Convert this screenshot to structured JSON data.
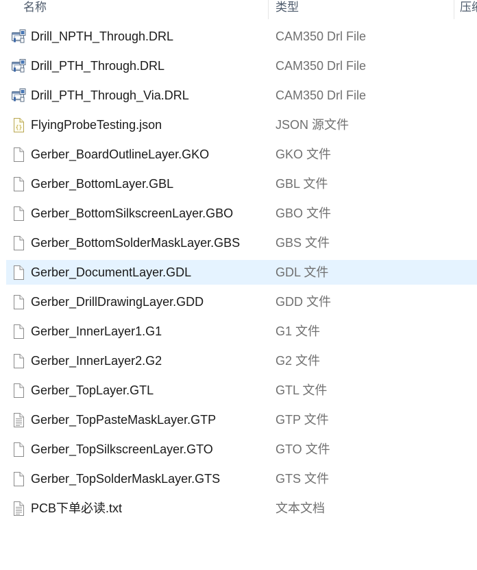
{
  "columns": {
    "name": "名称",
    "type": "类型",
    "size": "压缩"
  },
  "files": [
    {
      "name": "Drill_NPTH_Through.DRL",
      "type": "CAM350 Drl File",
      "icon": "cam350-drill-file-icon",
      "selected": false
    },
    {
      "name": "Drill_PTH_Through.DRL",
      "type": "CAM350 Drl File",
      "icon": "cam350-drill-file-icon",
      "selected": false
    },
    {
      "name": "Drill_PTH_Through_Via.DRL",
      "type": "CAM350 Drl File",
      "icon": "cam350-drill-file-icon",
      "selected": false
    },
    {
      "name": "FlyingProbeTesting.json",
      "type": "JSON 源文件",
      "icon": "json-file-icon",
      "selected": false
    },
    {
      "name": "Gerber_BoardOutlineLayer.GKO",
      "type": "GKO 文件",
      "icon": "blank-file-icon",
      "selected": false
    },
    {
      "name": "Gerber_BottomLayer.GBL",
      "type": "GBL 文件",
      "icon": "blank-file-icon",
      "selected": false
    },
    {
      "name": "Gerber_BottomSilkscreenLayer.GBO",
      "type": "GBO 文件",
      "icon": "blank-file-icon",
      "selected": false
    },
    {
      "name": "Gerber_BottomSolderMaskLayer.GBS",
      "type": "GBS 文件",
      "icon": "blank-file-icon",
      "selected": false
    },
    {
      "name": "Gerber_DocumentLayer.GDL",
      "type": "GDL 文件",
      "icon": "blank-file-icon",
      "selected": true
    },
    {
      "name": "Gerber_DrillDrawingLayer.GDD",
      "type": "GDD 文件",
      "icon": "blank-file-icon",
      "selected": false
    },
    {
      "name": "Gerber_InnerLayer1.G1",
      "type": "G1 文件",
      "icon": "blank-file-icon",
      "selected": false
    },
    {
      "name": "Gerber_InnerLayer2.G2",
      "type": "G2 文件",
      "icon": "blank-file-icon",
      "selected": false
    },
    {
      "name": "Gerber_TopLayer.GTL",
      "type": "GTL 文件",
      "icon": "blank-file-icon",
      "selected": false
    },
    {
      "name": "Gerber_TopPasteMaskLayer.GTP",
      "type": "GTP 文件",
      "icon": "text-file-icon",
      "selected": false
    },
    {
      "name": "Gerber_TopSilkscreenLayer.GTO",
      "type": "GTO 文件",
      "icon": "blank-file-icon",
      "selected": false
    },
    {
      "name": "Gerber_TopSolderMaskLayer.GTS",
      "type": "GTS 文件",
      "icon": "blank-file-icon",
      "selected": false
    },
    {
      "name": "PCB下单必读.txt",
      "type": "文本文档",
      "icon": "text-file-icon",
      "selected": false
    }
  ],
  "colors": {
    "selection": "#e5f3ff",
    "header_text": "#4d5a6b",
    "type_text": "#707070",
    "name_text": "#1a1a1a"
  }
}
